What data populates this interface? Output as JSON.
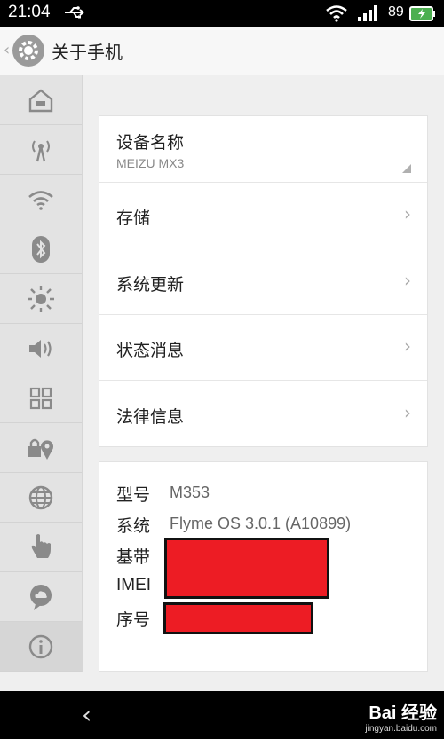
{
  "status_bar": {
    "time": "21:04",
    "battery": "89",
    "icons": [
      "usb-icon",
      "wifi-icon",
      "signal-icon",
      "battery-icon"
    ]
  },
  "header": {
    "title": "关于手机",
    "icon": "gear-icon"
  },
  "sidebar": {
    "items": [
      {
        "icon": "home-icon"
      },
      {
        "icon": "antenna-icon"
      },
      {
        "icon": "wifi-icon"
      },
      {
        "icon": "bluetooth-icon"
      },
      {
        "icon": "brightness-icon"
      },
      {
        "icon": "volume-icon"
      },
      {
        "icon": "apps-grid-icon"
      },
      {
        "icon": "lock-location-icon"
      },
      {
        "icon": "globe-icon"
      },
      {
        "icon": "hand-gesture-icon"
      },
      {
        "icon": "cloud-chat-icon"
      },
      {
        "icon": "info-icon",
        "active": true
      }
    ]
  },
  "menu": {
    "device_name_label": "设备名称",
    "device_name_value": "MEIZU MX3",
    "items": [
      {
        "label": "存储"
      },
      {
        "label": "系统更新"
      },
      {
        "label": "状态消息"
      },
      {
        "label": "法律信息"
      }
    ]
  },
  "info": {
    "model_label": "型号",
    "model_value": "M353",
    "system_label": "系统",
    "system_value": "Flyme OS 3.0.1 (A10899)",
    "baseband_label": "基带",
    "imei_label": "IMEI",
    "serial_label": "序号"
  },
  "watermark": {
    "logo": "Bai 经验",
    "url": "jingyan.baidu.com"
  },
  "colors": {
    "redaction": "#ed1c24",
    "sidebar_bg": "#e3e3e3",
    "card_bg": "#ffffff"
  }
}
